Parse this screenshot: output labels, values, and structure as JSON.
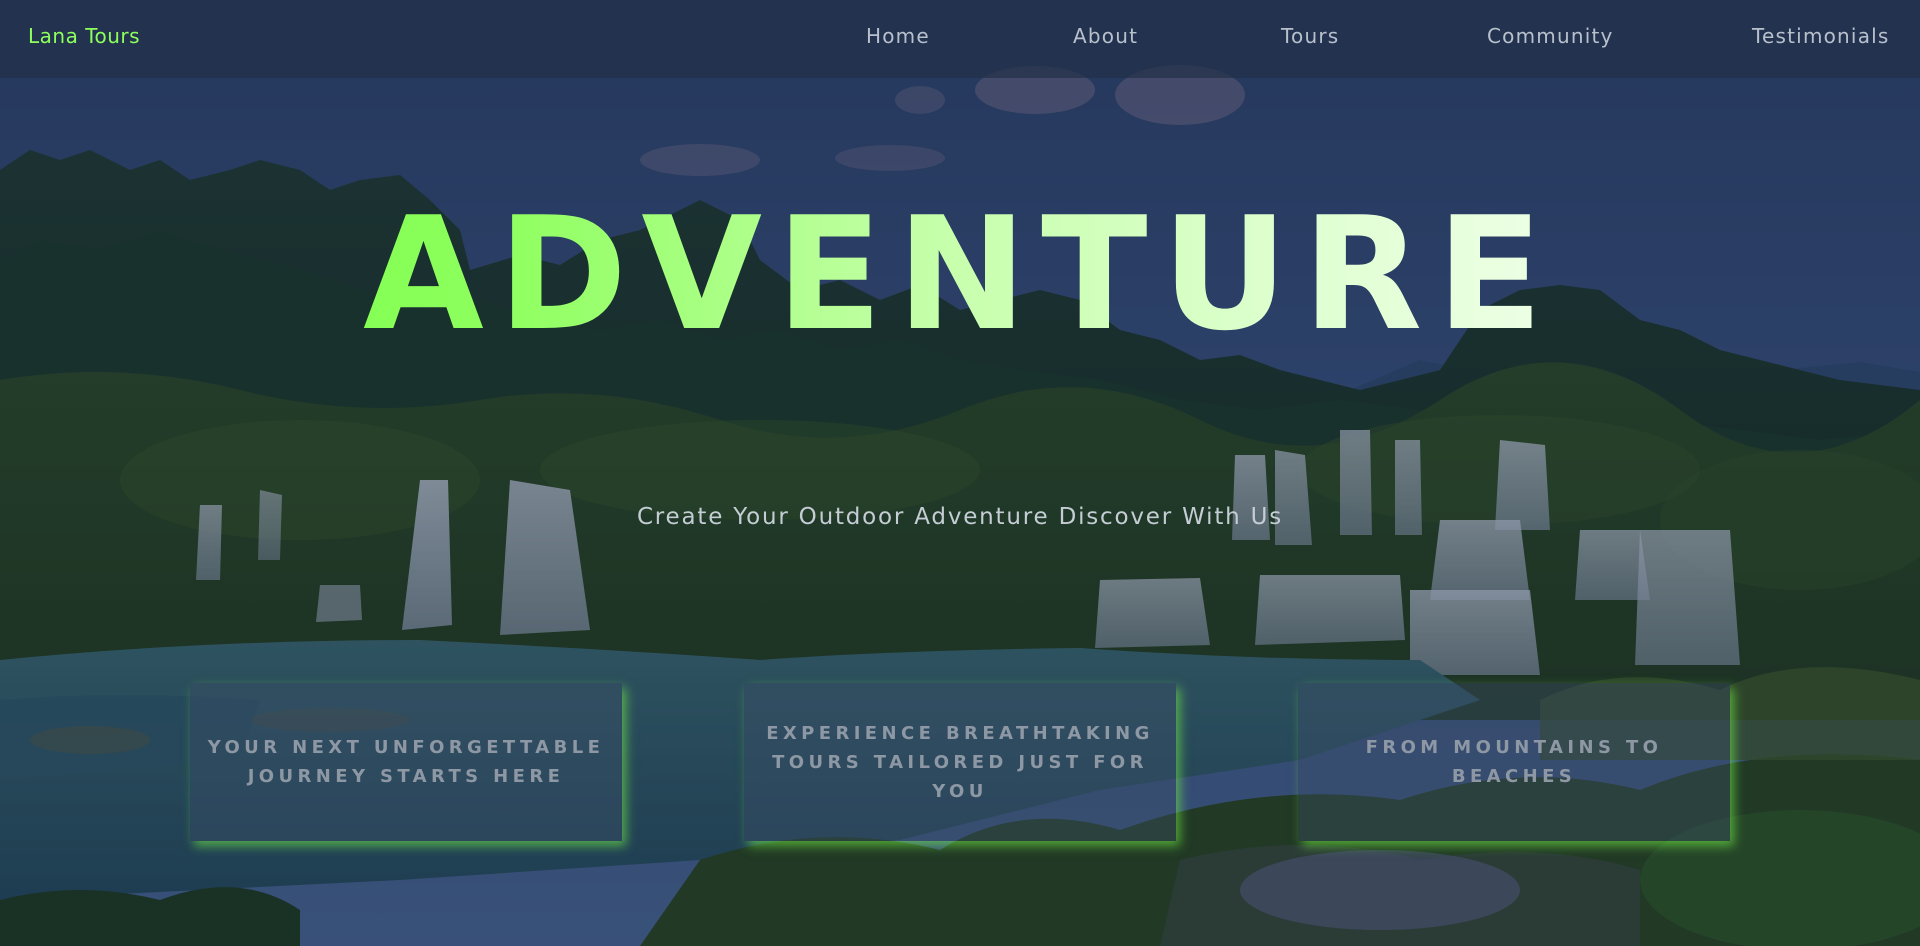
{
  "brand": {
    "name": "Lana Tours",
    "color": "#8dff5c"
  },
  "nav": {
    "items": [
      {
        "label": "Home"
      },
      {
        "label": "About"
      },
      {
        "label": "Tours"
      },
      {
        "label": "Community"
      },
      {
        "label": "Testimonials"
      }
    ]
  },
  "hero": {
    "title": "ADVENTURE",
    "subtitle": "Create Your Outdoor Adventure Discover With Us",
    "background": "waterfall-landscape-image"
  },
  "cards": [
    {
      "text": "YOUR NEXT UNFORGETTABLE JOURNEY STARTS HERE"
    },
    {
      "text": "EXPERIENCE BREATHTAKING TOURS TAILORED JUST FOR YOU"
    },
    {
      "text": "FROM MOUNTAINS TO BEACHES"
    }
  ],
  "colors": {
    "accent": "#8dff5c",
    "nav_text": "#b8c0cc",
    "card_glow": "#78ff46"
  }
}
